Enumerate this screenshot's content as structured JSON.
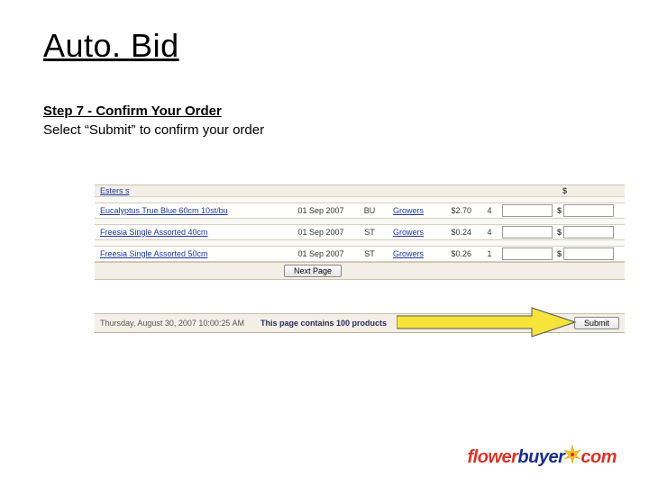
{
  "title": "Auto. Bid",
  "step_heading": "Step 7 - Confirm Your Order",
  "step_desc": "Select “Submit” to confirm your order",
  "grid": {
    "header_stub": "Esters s",
    "rows": [
      {
        "product": "Eucalyptus True Blue 60cm 10st/bu",
        "date": "01 Sep 2007",
        "code": "BU",
        "grower": "Growers",
        "price": "$2.70",
        "units": "4",
        "input": ""
      },
      {
        "product": "Freesia Single Assorted 40cm",
        "date": "01 Sep 2007",
        "code": "ST",
        "grower": "Growers",
        "price": "$0.24",
        "units": "4",
        "input": ""
      },
      {
        "product": "Freesia Single Assorted 50cm",
        "date": "01 Sep 2007",
        "code": "ST",
        "grower": "Growers",
        "price": "$0.26",
        "units": "1",
        "input": ""
      }
    ],
    "next_page_label": "Next Page"
  },
  "status": {
    "timestamp": "Thursday, August 30, 2007  10:00:25 AM",
    "count_text": "This page contains 100 products",
    "submit_label": "Submit"
  },
  "logo": {
    "part1": "flower",
    "part2": "buyer",
    "part3": "com"
  }
}
